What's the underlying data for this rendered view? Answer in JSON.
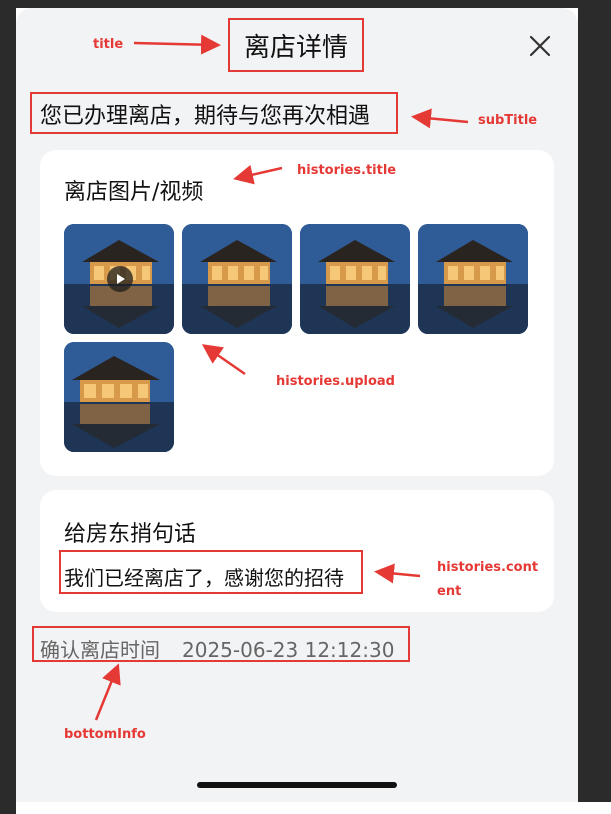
{
  "sheet": {
    "title": "离店详情",
    "subTitle": "您已办理离店，期待与您再次相遇"
  },
  "histories": {
    "title": "离店图片/视频",
    "upload": [
      {
        "kind": "video",
        "icon": "play-icon"
      },
      {
        "kind": "image"
      },
      {
        "kind": "image"
      },
      {
        "kind": "image"
      },
      {
        "kind": "image"
      }
    ],
    "message_title": "给房东捎句话",
    "content": "我们已经离店了，感谢您的招待"
  },
  "bottomInfo": {
    "label": "确认离店时间",
    "time": "2025-06-23 12:12:30"
  },
  "annotations": {
    "title": "title",
    "subTitle": "subTitle",
    "histories_title": "histories.title",
    "histories_upload": "histories.upload",
    "histories_content_1": "histories.cont",
    "histories_content_2": "ent",
    "bottomInfo": "bottomInfo"
  },
  "colors": {
    "annotation": "#e53935",
    "sheet_background": "#f2f3f5",
    "card_background": "#ffffff"
  }
}
